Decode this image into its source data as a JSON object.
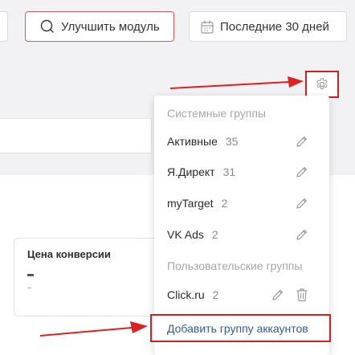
{
  "toolbar": {
    "improve_label": "Улучшить модуль",
    "period_label": "Последние 30 дней"
  },
  "card": {
    "title": "Цена конверсии"
  },
  "dropdown": {
    "system_header": "Системные группы",
    "system_groups": [
      {
        "name": "Активные",
        "count": "35"
      },
      {
        "name": "Я.Директ",
        "count": "31"
      },
      {
        "name": "myTarget",
        "count": "2"
      },
      {
        "name": "VK Ads",
        "count": "2"
      }
    ],
    "user_header": "Пользовательские группы",
    "user_groups": [
      {
        "name": "Click.ru",
        "count": "2"
      }
    ],
    "add_label": "Добавить группу аккаунтов"
  },
  "colors": {
    "accent_red": "#d61f1f",
    "link_blue": "#2d5c9e",
    "muted": "#a6a6a6"
  },
  "icons": [
    "search-icon",
    "calendar-icon",
    "gear-icon",
    "pencil-icon",
    "trash-icon",
    "arrow-annotation"
  ]
}
